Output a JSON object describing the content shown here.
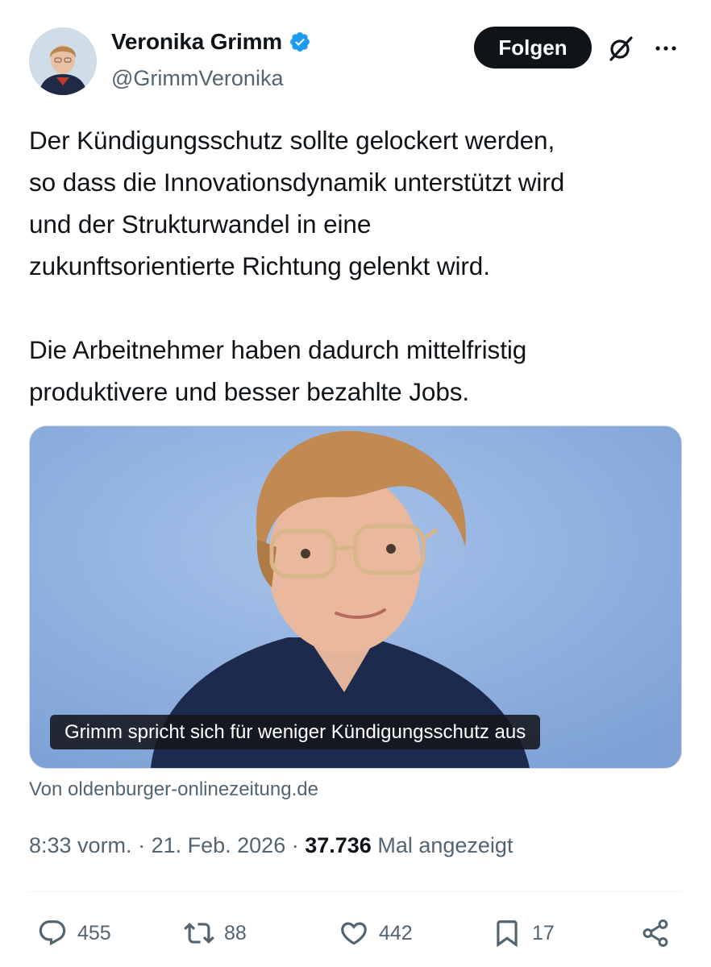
{
  "author": {
    "name": "Veronika Grimm",
    "handle": "@GrimmVeronika",
    "verified": true
  },
  "header": {
    "follow_label": "Folgen"
  },
  "tweet": {
    "text": "Der Kündigungsschutz sollte gelockert werden,\nso dass die Innovationsdynamik unterstützt wird\nund der Strukturwandel in eine\nzukunftsorientierte Richtung gelenkt wird.\n\nDie Arbeitnehmer haben dadurch mittelfristig\nproduktivere und besser bezahlte Jobs."
  },
  "media": {
    "caption": "Grimm spricht sich für weniger Kündigungsschutz aus",
    "source": "Von oldenburger-onlinezeitung.de"
  },
  "meta": {
    "time": "8:33 vorm.",
    "date": "21. Feb. 2026",
    "views_count": "37.736",
    "views_label": "Mal angezeigt"
  },
  "actions": {
    "replies": "455",
    "reposts": "88",
    "likes": "442",
    "bookmarks": "17"
  },
  "icons": [
    "verified-badge-icon",
    "grok-icon",
    "more-icon",
    "reply-icon",
    "repost-icon",
    "like-icon",
    "bookmark-icon",
    "share-icon"
  ],
  "colors": {
    "verified": "#1d9bf0",
    "text": "#0f1419",
    "secondary": "#536471",
    "photo_background": "#8aaede"
  }
}
